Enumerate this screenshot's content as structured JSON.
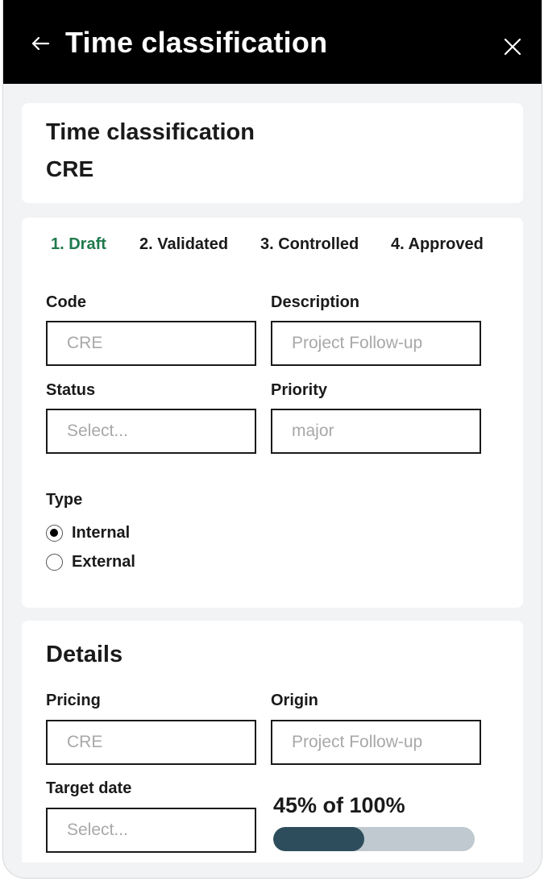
{
  "header": {
    "title": "Time classification",
    "back_icon": "arrow-left-icon",
    "close_icon": "close-icon"
  },
  "summary": {
    "title": "Time classification",
    "code": "CRE"
  },
  "steps": [
    {
      "label": "1. Draft",
      "active": true
    },
    {
      "label": "2. Validated",
      "active": false
    },
    {
      "label": "3. Controlled",
      "active": false
    },
    {
      "label": "4. Approved",
      "active": false
    }
  ],
  "form": {
    "code": {
      "label": "Code",
      "placeholder": "CRE"
    },
    "description": {
      "label": "Description",
      "placeholder": "Project Follow-up"
    },
    "status": {
      "label": "Status",
      "placeholder": "Select..."
    },
    "priority": {
      "label": "Priority",
      "placeholder": "major"
    },
    "type": {
      "label": "Type",
      "options": [
        {
          "label": "Internal",
          "checked": true
        },
        {
          "label": "External",
          "checked": false
        }
      ]
    }
  },
  "details": {
    "title": "Details",
    "pricing": {
      "label": "Pricing",
      "placeholder": "CRE"
    },
    "origin": {
      "label": "Origin",
      "placeholder": "Project Follow-up"
    },
    "target_date": {
      "label": "Target date",
      "placeholder": "Select..."
    },
    "progress": {
      "text": "45% of 100%",
      "value": 45,
      "max": 100
    }
  },
  "colors": {
    "topbar": "#000000",
    "active_step": "#1f7a4d",
    "progress_fill": "#2e4d5c",
    "progress_track": "#bfc9cf"
  }
}
